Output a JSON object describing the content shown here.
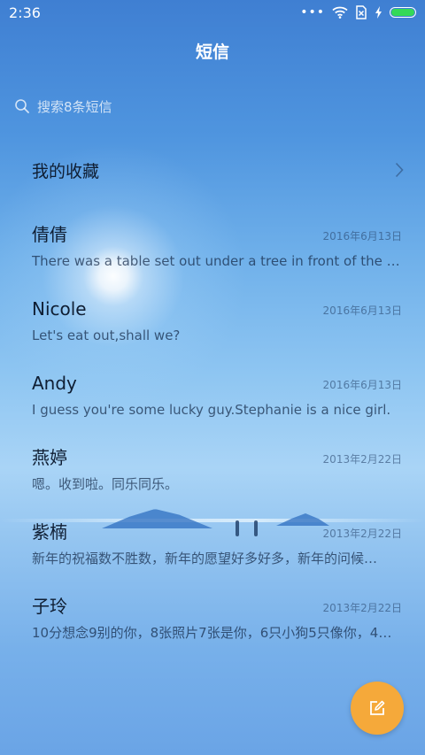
{
  "status_bar": {
    "time": "2:36",
    "icons": [
      "more-dots-icon",
      "wifi-icon",
      "no-sim-icon",
      "charging-icon",
      "battery-icon"
    ],
    "battery_color": "#34d957"
  },
  "header": {
    "title": "短信"
  },
  "search": {
    "placeholder": "搜索8条短信"
  },
  "favorites": {
    "label": "我的收藏"
  },
  "conversations": [
    {
      "name": "倩倩",
      "date": "2016年6月13日",
      "snippet": "There was a table set out under a tree in front of the ho…"
    },
    {
      "name": "Nicole",
      "date": "2016年6月13日",
      "snippet": "Let's eat out,shall we?"
    },
    {
      "name": "Andy",
      "date": "2016年6月13日",
      "snippet": "I guess you're some lucky guy.Stephanie is a nice girl."
    },
    {
      "name": "燕婷",
      "date": "2013年2月22日",
      "snippet": "嗯。收到啦。同乐同乐。"
    },
    {
      "name": "紫楠",
      "date": "2013年2月22日",
      "snippet": "新年的祝福数不胜数，新年的愿望好多好多，新年的问候…"
    },
    {
      "name": "子玲",
      "date": "2013年2月22日",
      "snippet": "10分想念9别的你，8张照片7张是你，6只小狗5只像你，4…"
    }
  ],
  "fab": {
    "icon": "compose-icon",
    "color": "#f5a93a"
  }
}
